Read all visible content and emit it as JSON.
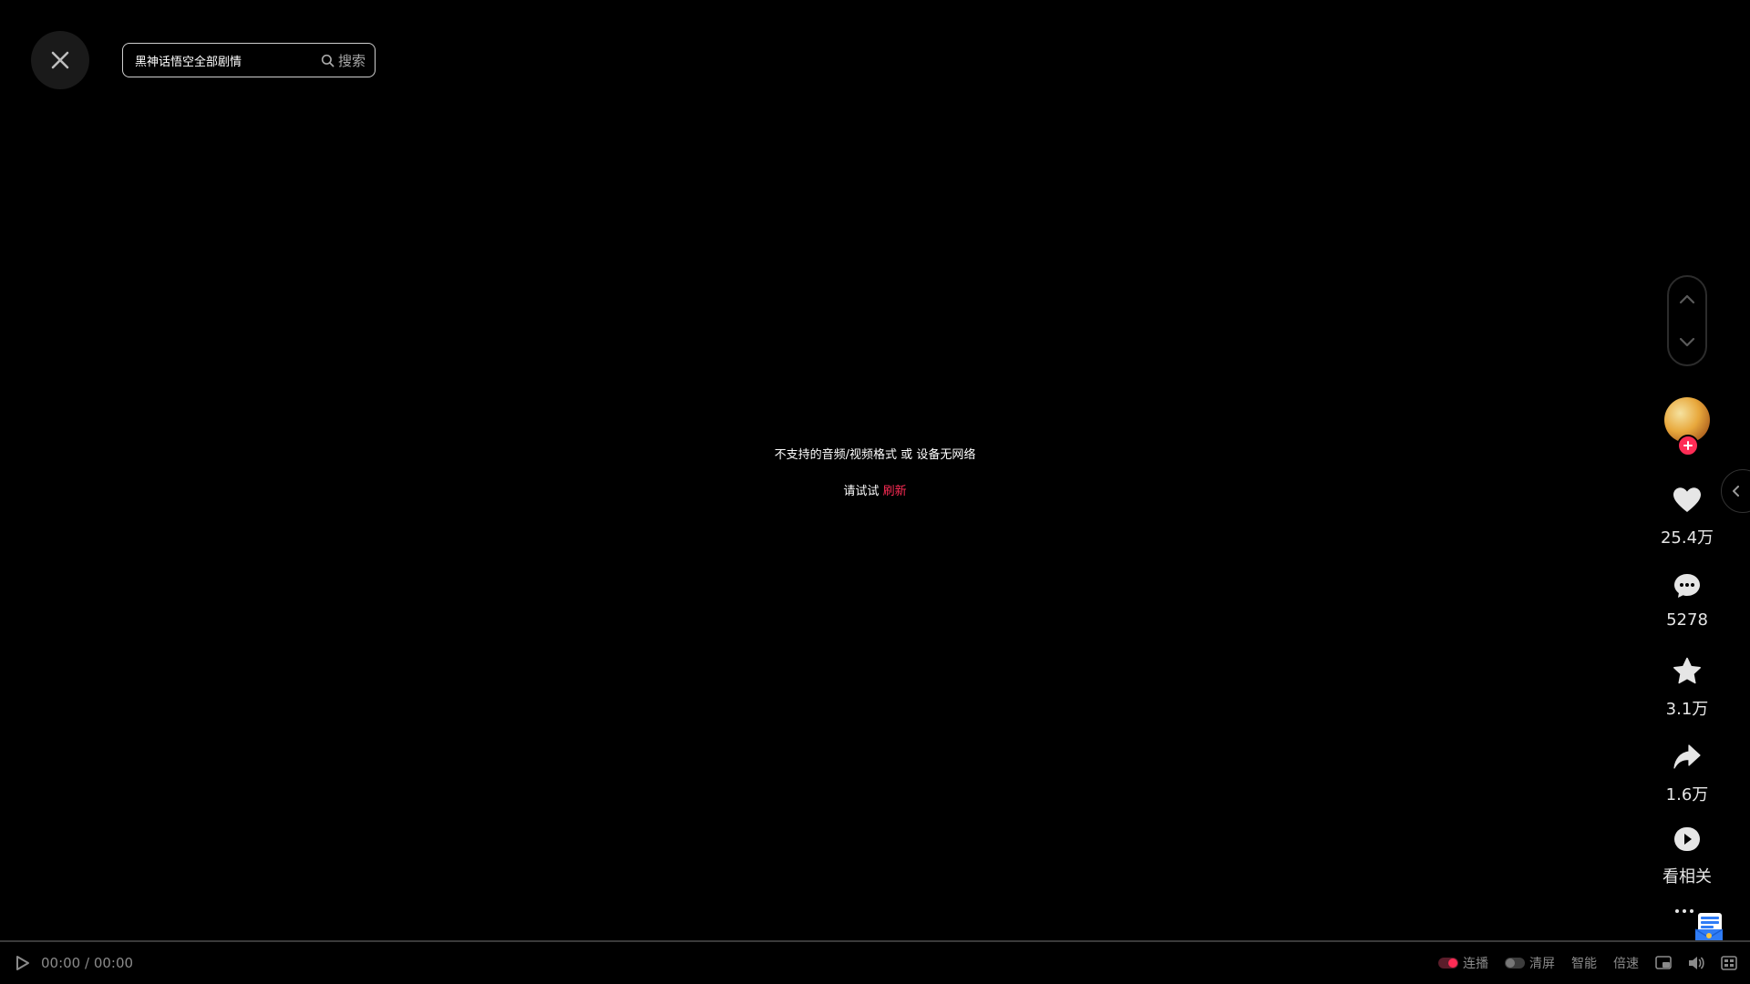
{
  "search": {
    "value": "黑神话悟空全部剧情",
    "button_label": "搜索"
  },
  "error": {
    "message": "不支持的音频/视频格式 或 设备无网络",
    "retry_prefix": "请试试",
    "retry_link": "刷新"
  },
  "actions": {
    "likes": "25.4万",
    "comments": "5278",
    "favorites": "3.1万",
    "shares": "1.6万",
    "related_label": "看相关"
  },
  "player": {
    "time": "00:00 / 00:00",
    "autoplay_label": "连播",
    "autoplay_on": true,
    "clear_screen_label": "清屏",
    "clear_screen_on": false,
    "smart_label": "智能",
    "speed_label": "倍速"
  },
  "colors": {
    "accent": "#fe2c55",
    "background": "#000000",
    "muted_text": "#8a8a8a"
  },
  "icons": {
    "close": "close-icon",
    "search": "search-icon",
    "nav_up": "chevron-up-icon",
    "nav_down": "chevron-down-icon",
    "follow": "plus-icon",
    "like": "heart-icon",
    "comment": "comment-icon",
    "favorite": "star-icon",
    "share": "share-icon",
    "related": "play-circle-icon",
    "more": "more-icon",
    "play": "play-icon",
    "pip": "picture-in-picture-icon",
    "volume": "volume-icon",
    "fullscreen": "fullscreen-icon"
  }
}
